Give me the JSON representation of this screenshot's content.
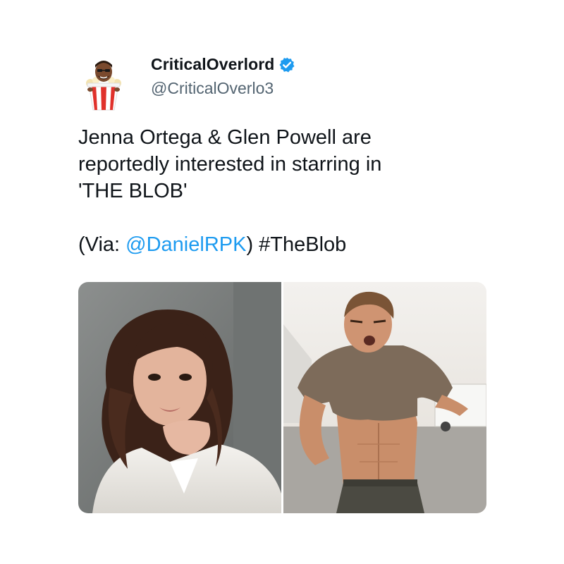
{
  "author": {
    "display_name": "CriticalOverlord",
    "handle": "@CriticalOverlo3",
    "verified": true,
    "avatar_icon": "popcorn-bucket-avatar-icon",
    "verified_color": "#1d9bf0"
  },
  "tweet": {
    "lines": [
      "Jenna Ortega & Glen Powell are",
      "reportedly interested in starring in",
      "'THE BLOB'"
    ],
    "via_prefix": "(Via: ",
    "via_mention": "@DanielRPK",
    "via_suffix": ") ",
    "hashtag": "#TheBlob"
  },
  "media": [
    {
      "description": "woman-portrait-photo"
    },
    {
      "description": "man-lifting-shirt-photo"
    }
  ],
  "colors": {
    "text": "#0f1419",
    "secondary": "#536471",
    "link": "#1d9bf0"
  }
}
